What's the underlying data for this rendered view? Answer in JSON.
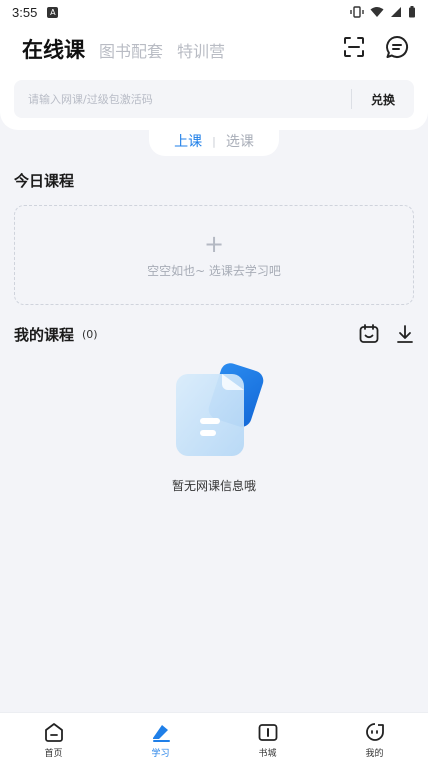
{
  "status_bar": {
    "time": "3:55",
    "notif_letter": "A"
  },
  "header": {
    "tabs": [
      "在线课",
      "图书配套",
      "特训营"
    ],
    "search": {
      "placeholder": "请输入网课/过级包激活码",
      "value": "",
      "redeem_label": "兑换"
    }
  },
  "subtabs": [
    "上课",
    "选课"
  ],
  "today": {
    "title": "今日课程",
    "empty_text": "空空如也~ 选课去学习吧"
  },
  "my_courses": {
    "title": "我的课程",
    "count": "(0)",
    "empty_text": "暂无网课信息哦"
  },
  "bottom_nav": [
    {
      "label": "首页",
      "icon": "home-icon"
    },
    {
      "label": "学习",
      "icon": "study-icon",
      "active": true
    },
    {
      "label": "书城",
      "icon": "book-icon"
    },
    {
      "label": "我的",
      "icon": "profile-icon"
    }
  ],
  "colors": {
    "accent": "#1f7fe8",
    "background": "#f3f4f8",
    "muted": "#b9bcc4"
  }
}
